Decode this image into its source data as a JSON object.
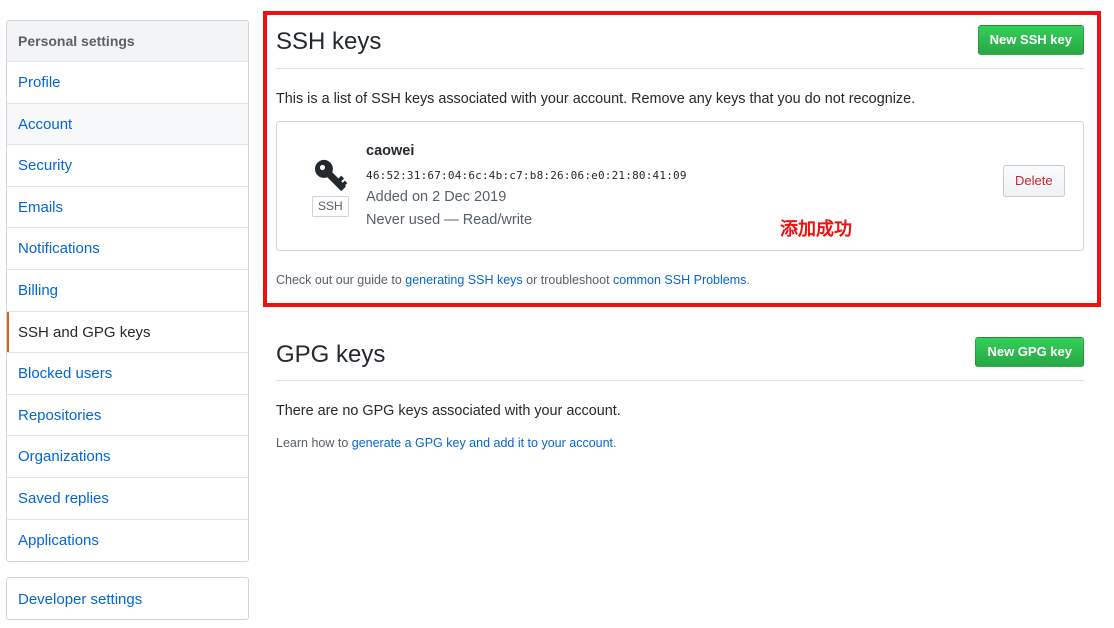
{
  "sidebar": {
    "heading": "Personal settings",
    "items": [
      {
        "label": "Profile"
      },
      {
        "label": "Account"
      },
      {
        "label": "Security"
      },
      {
        "label": "Emails"
      },
      {
        "label": "Notifications"
      },
      {
        "label": "Billing"
      },
      {
        "label": "SSH and GPG keys"
      },
      {
        "label": "Blocked users"
      },
      {
        "label": "Repositories"
      },
      {
        "label": "Organizations"
      },
      {
        "label": "Saved replies"
      },
      {
        "label": "Applications"
      }
    ],
    "selected_index": 6,
    "developer_settings": "Developer settings"
  },
  "ssh": {
    "title": "SSH keys",
    "new_button": "New SSH key",
    "description": "This is a list of SSH keys associated with your account. Remove any keys that you do not recognize.",
    "key": {
      "icon": "key-icon",
      "type_label": "SSH",
      "title": "caowei",
      "fingerprint": "46:52:31:67:04:6c:4b:c7:b8:26:06:e0:21:80:41:09",
      "added": "Added on 2 Dec 2019",
      "usage": "Never used — Read/write",
      "delete_button": "Delete"
    },
    "annotation": "添加成功",
    "guide": {
      "prefix": "Check out our guide to ",
      "link1": "generating SSH keys",
      "middle": " or troubleshoot ",
      "link2": "common SSH Problems",
      "suffix": "."
    }
  },
  "gpg": {
    "title": "GPG keys",
    "new_button": "New GPG key",
    "empty_text": "There are no GPG keys associated with your account.",
    "learn": {
      "prefix": "Learn how to ",
      "link": "generate a GPG key and add it to your account",
      "suffix": "."
    }
  },
  "colors": {
    "primary_green": "#28a745",
    "link_blue": "#0366d6",
    "danger_red": "#cb2431",
    "annotation_red": "#ee1111",
    "selected_accent": "#e36209"
  }
}
